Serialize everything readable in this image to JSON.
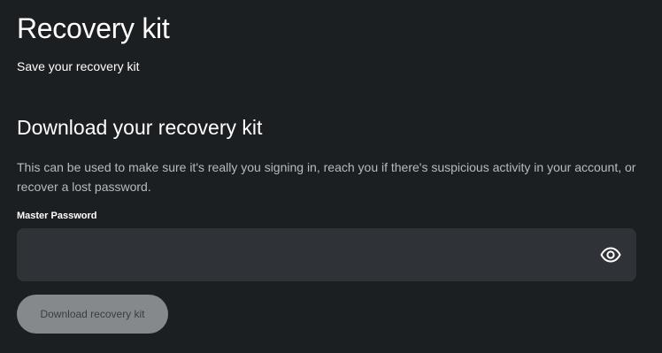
{
  "header": {
    "title": "Recovery kit",
    "subtitle": "Save your recovery kit"
  },
  "section": {
    "title": "Download your recovery kit",
    "description": "This can be used to make sure it's really you signing in, reach you if there's suspicious activity in your account, or recover a lost password."
  },
  "password_field": {
    "label": "Master Password",
    "value": "",
    "placeholder": "",
    "toggle_icon": "eye-icon"
  },
  "actions": {
    "download_label": "Download recovery kit"
  },
  "colors": {
    "background": "#1c1f22",
    "input_background": "#2f3337",
    "button_disabled": "#85898c",
    "muted_text": "#b6bbc0"
  }
}
